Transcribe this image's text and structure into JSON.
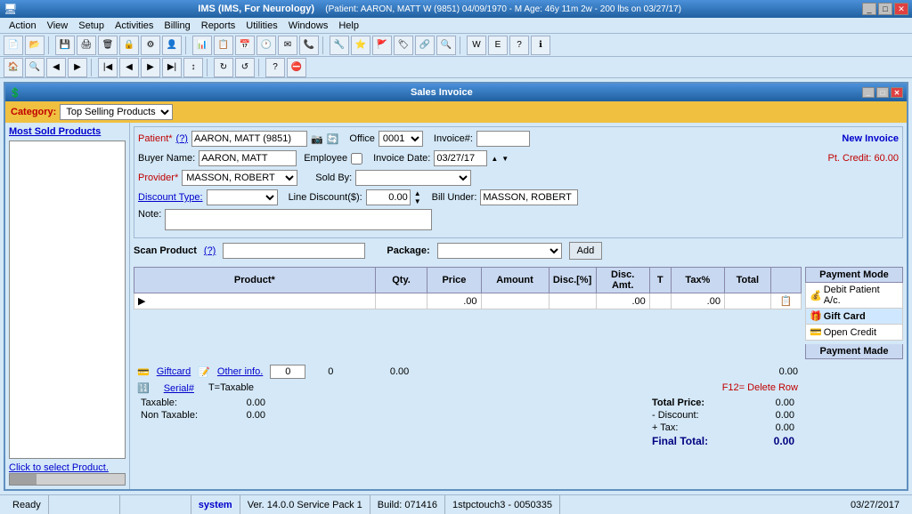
{
  "app": {
    "title": "IMS (IMS, For Neurology)",
    "patient_info": "(Patient: AARON, MATT W (9851) 04/09/1970 - M Age: 46y 11m 2w - 200 lbs on 03/27/17)"
  },
  "menu": {
    "items": [
      "Action",
      "View",
      "Setup",
      "Activities",
      "Billing",
      "Reports",
      "Utilities",
      "Windows",
      "Help"
    ]
  },
  "invoice": {
    "title": "Sales Invoice",
    "category_label": "Category:",
    "category_value": "Top Selling Products",
    "most_sold_title": "Most Sold Products",
    "patient_label": "Patient*",
    "patient_value": "(?) AARON, MATT (9851)",
    "office_label": "Office",
    "office_value": "0001",
    "invoice_num_label": "Invoice#:",
    "invoice_num_value": "",
    "new_invoice_label": "New Invoice",
    "pt_credit_label": "Pt. Credit: 60.00",
    "buyer_name_label": "Buyer Name:",
    "buyer_name_value": "AARON, MATT",
    "employee_label": "Employee",
    "invoice_date_label": "Invoice Date:",
    "invoice_date_value": "03/27/17",
    "provider_label": "Provider*",
    "provider_value": "MASSON, ROBERT",
    "sold_by_label": "Sold By:",
    "sold_by_value": "",
    "discount_type_label": "Discount Type:",
    "discount_type_value": "",
    "line_discount_label": "Line Discount($):",
    "line_discount_value": "0.00",
    "bill_under_label": "Bill Under:",
    "bill_under_value": "MASSON, ROBERT",
    "note_label": "Note:",
    "scan_product_label": "Scan Product",
    "scan_product_hint": "(?)",
    "package_label": "Package:",
    "add_button_label": "Add",
    "table": {
      "headers": [
        "Product*",
        "Qty.",
        "Price",
        "Amount",
        "Disc.[%]",
        "Disc. Amt.",
        "T",
        "Tax%",
        "Total",
        ""
      ],
      "row": {
        "qty": "",
        "price": ".00",
        "amount": "",
        "disc_pct": "",
        "disc_amt": ".00",
        "t": "",
        "tax_pct": ".00",
        "total": ""
      }
    },
    "giftcard_label": "Giftcard",
    "other_info_label": "Other info.",
    "serial_label": "Serial#",
    "taxable_label": "T=Taxable",
    "qty_total": "0",
    "price_total": "0",
    "amount_total": "0.00",
    "total_total": "0.00",
    "f12_delete_label": "F12= Delete Row",
    "taxable_total_label": "Taxable:",
    "taxable_total_value": "0.00",
    "non_taxable_label": "Non Taxable:",
    "non_taxable_value": "0.00",
    "total_price_label": "Total Price:",
    "total_price_value": "0.00",
    "discount_label": "- Discount:",
    "discount_value": "0.00",
    "tax_label": "+ Tax:",
    "tax_value": "0.00",
    "final_total_label": "Final Total:",
    "final_total_value": "0.00",
    "payment_mode_title": "Payment Mode",
    "payment_modes": [
      {
        "label": "Debit Patient A/c.",
        "icon": "money"
      },
      {
        "label": "Gift Card",
        "icon": "gift"
      },
      {
        "label": "Open Credit",
        "icon": "credit"
      }
    ],
    "payment_made_title": "Payment Made",
    "click_to_select": "Click to select Product."
  },
  "status_bar": {
    "ready_label": "Ready",
    "user_label": "system",
    "version_label": "Ver. 14.0.0 Service Pack 1",
    "build_label": "Build: 071416",
    "server_label": "1stpctouch3 - 0050335",
    "date_label": "03/27/2017"
  }
}
